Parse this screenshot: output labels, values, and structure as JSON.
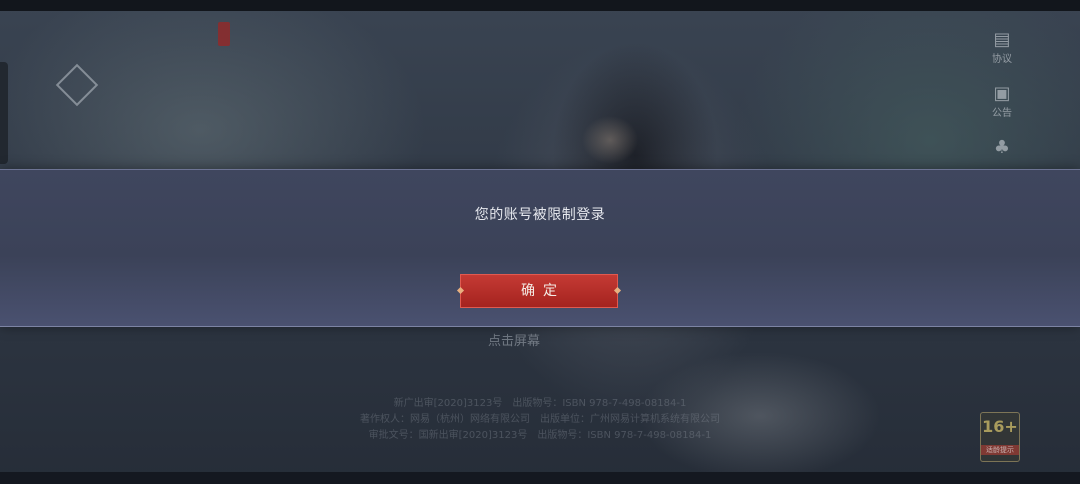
{
  "background": {
    "tap_hint": "点击屏幕",
    "footer_lines": [
      "新广出审[2020]3123号　出版物号：ISBN 978-7-498-08184-1",
      "著作权人：网易（杭州）网络有限公司　出版单位：广州网易计算机系统有限公司",
      "审批文号：国新出审[2020]3123号　出版物号：ISBN 978-7-498-08184-1"
    ],
    "age_rating": "16+",
    "age_rating_label": "适龄提示"
  },
  "side_menu": [
    {
      "label": "协议",
      "icon": "document-icon"
    },
    {
      "label": "公告",
      "icon": "notice-icon"
    },
    {
      "label": "",
      "icon": "people-icon"
    }
  ],
  "dialog": {
    "message": "您的账号被限制登录",
    "confirm_label": "确定"
  },
  "colors": {
    "dialog_bg": "#3d4459",
    "button_red": "#b42d28"
  }
}
